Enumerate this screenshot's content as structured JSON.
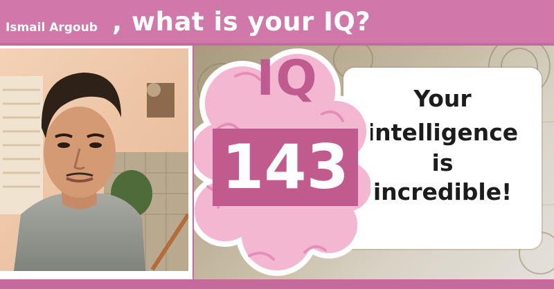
{
  "header": {
    "user_name": "Ismail Argoub",
    "question": ", what is your IQ?"
  },
  "result": {
    "label": "IQ",
    "score": "143",
    "message_lines": [
      "Your",
      "intelligence",
      "is",
      "incredible!"
    ]
  },
  "colors": {
    "pink_bar": "#cf78a9",
    "brain_pink": "#f4b7d2",
    "score_box": "#c15a8d",
    "iq_text": "#c05b8f"
  }
}
